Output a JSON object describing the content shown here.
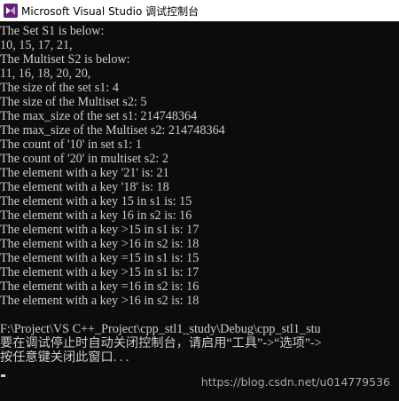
{
  "window": {
    "title": "Microsoft Visual Studio 调试控制台",
    "icon": "visual-studio-icon",
    "accent": "#68217a"
  },
  "console": {
    "lines": [
      "The Set S1 is below:",
      "10, 15, 17, 21,",
      "The Multiset S2 is below:",
      "11, 16, 18, 20, 20,",
      "The size of the set s1: 4",
      "The size of the Multiset s2: 5",
      "The max_size of the set s1: 214748364",
      "The max_size of the Multiset s2: 214748364",
      "The count of '10' in set s1: 1",
      "The count of '20' in multiset s2: 2",
      "The element with a key '21' is: 21",
      "The element with a key '18' is: 18",
      "The element with a key 15 in s1 is: 15",
      "The element with a key 16 in s2 is: 16",
      "The element with a key >15 in s1 is: 17",
      "The element with a key >16 in s2 is: 18",
      "The element with a key =15 in s1 is: 15",
      "The element with a key >15 in s1 is: 17",
      "The element with a key =16 in s2 is: 16",
      "The element with a key >16 in s2 is: 18"
    ],
    "footer": [
      "F:\\Project\\VS C++_Project\\cpp_stl1_study\\Debug\\cpp_stl1_stu",
      "要在调试停止时自动关闭控制台，请启用“工具”->“选项”->",
      "按任意键关闭此窗口. . ."
    ]
  },
  "watermark": "https://blog.csdn.net/u014779536",
  "colors": {
    "background": "#0c0c0c",
    "text": "#cccccc",
    "titlebar": "#ffffff"
  }
}
